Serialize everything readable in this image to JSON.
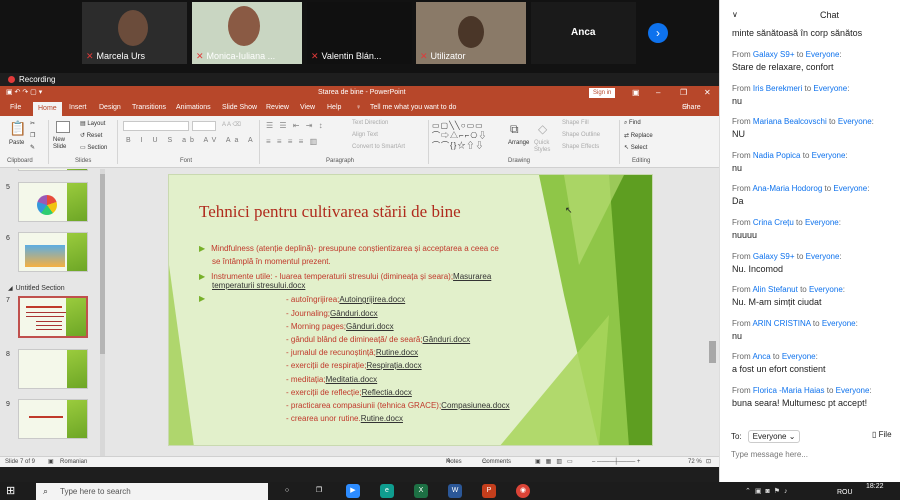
{
  "participants": [
    {
      "name": "Marcela Urs",
      "muted": true
    },
    {
      "name": "Monica-Iuliana ...",
      "muted": true
    },
    {
      "name": "Valentin Blán...",
      "muted": true
    },
    {
      "name": "Utilizator",
      "muted": true
    },
    {
      "name": "Anca",
      "muted": true
    }
  ],
  "recording_label": "Recording",
  "ppt": {
    "doc_title": "Starea de bine  -  PowerPoint",
    "sign_in": "Sign in",
    "menu": [
      "File",
      "Home",
      "Insert",
      "Design",
      "Transitions",
      "Animations",
      "Slide Show",
      "Review",
      "View",
      "Help"
    ],
    "tell_me": "Tell me what you want to do",
    "share": "Share",
    "ribbon": {
      "paste": "Paste",
      "new_slide": "New Slide",
      "layout": "Layout",
      "reset": "Reset",
      "section": "Section",
      "text_direction": "Text Direction",
      "align_text": "Align Text",
      "convert_smartart": "Convert to SmartArt",
      "arrange": "Arrange",
      "quick_styles": "Quick Styles",
      "shape_fill": "Shape Fill",
      "shape_outline": "Shape Outline",
      "shape_effects": "Shape Effects",
      "find": "Find",
      "replace": "Replace",
      "select": "Select",
      "groups": [
        "Clipboard",
        "Slides",
        "Font",
        "Paragraph",
        "Drawing",
        "Editing"
      ]
    },
    "thumbnails": [
      {
        "num": "5",
        "label": ""
      },
      {
        "num": "6",
        "label": ""
      },
      {
        "num": "7",
        "label": ""
      },
      {
        "num": "8",
        "label": ""
      },
      {
        "num": "9",
        "label": ""
      }
    ],
    "section_name": "Untitled Section",
    "slide": {
      "title": "Tehnici pentru cultivarea stării de bine",
      "bullet1": "Mindfulness (atenție deplină)- presupune conștientizarea și acceptarea a ceea ce",
      "bullet1_cont": "se întâmplă în momentul prezent.",
      "bullet2": "Instrumente utile: - luarea temperaturii stresului (dimineața și seara);",
      "bullet2_link": "Masurarea",
      "bullet2_link2": "temperaturii stresului.docx",
      "items": [
        {
          "text": "- autoîngrijirea;",
          "link": "Autoingrijirea.docx"
        },
        {
          "text": "- Journaling;",
          "link": "Gânduri.docx"
        },
        {
          "text": "- Morning pages;",
          "link": "Gânduri.docx"
        },
        {
          "text": "- gândul blând de dimineață/ de seară;",
          "link": "Gânduri.docx"
        },
        {
          "text": "- jurnalul de recunoștință;",
          "link": "Rutine.docx"
        },
        {
          "text": "- exerciții de respirație;",
          "link": "Respirația.docx"
        },
        {
          "text": "- meditația;",
          "link": "Meditatia.docx"
        },
        {
          "text": "- exerciții de reflecție;",
          "link": "Reflectia.docx"
        },
        {
          "text": "- practicarea compasiunii (tehnica GRACE);",
          "link": "Compasiunea.docx"
        },
        {
          "text": "- crearea unor rutine.",
          "link": "Rutine.docx"
        }
      ]
    },
    "status": {
      "slide_of": "Slide 7 of 9",
      "language": "Romanian",
      "notes": "Notes",
      "comments": "Comments",
      "zoom": "72 %"
    }
  },
  "chat": {
    "title": "Chat",
    "first_line": "minte sănătoasă în corp sănătos",
    "messages": [
      {
        "from": "Galaxy S9+",
        "to": "Everyone",
        "text": "Stare de relaxare, confort"
      },
      {
        "from": "Iris Berekmeri",
        "to": "Everyone",
        "text": "nu"
      },
      {
        "from": "Mariana Bealcovschi",
        "to": "Everyone",
        "text": "NU"
      },
      {
        "from": "Nadia Popica",
        "to": "Everyone",
        "text": "nu"
      },
      {
        "from": "Ana-Maria Hodorog",
        "to": "Everyone",
        "text": "Da"
      },
      {
        "from": "Crina Crețu",
        "to": "Everyone",
        "text": "nuuuu"
      },
      {
        "from": "Galaxy S9+",
        "to": "Everyone",
        "text": "Nu. Incomod"
      },
      {
        "from": "Alin Stefanut",
        "to": "Everyone",
        "text": "Nu. M-am simțit ciudat"
      },
      {
        "from": "ARIN CRISTINA",
        "to": "Everyone",
        "text": "nu"
      },
      {
        "from": "Anca",
        "to": "Everyone",
        "text": "a fost un efort constient"
      },
      {
        "from": "Florica -Maria Haias",
        "to": "Everyone",
        "text": "buna seara! Multumesc pt accept!"
      }
    ],
    "from_label": "From",
    "to_label": "to",
    "to_field_label": "To:",
    "to_value": "Everyone",
    "file_label": "File",
    "input_placeholder": "Type message here..."
  },
  "taskbar": {
    "search_placeholder": "Type here to search",
    "lang": "ROU",
    "time": "18:22"
  }
}
